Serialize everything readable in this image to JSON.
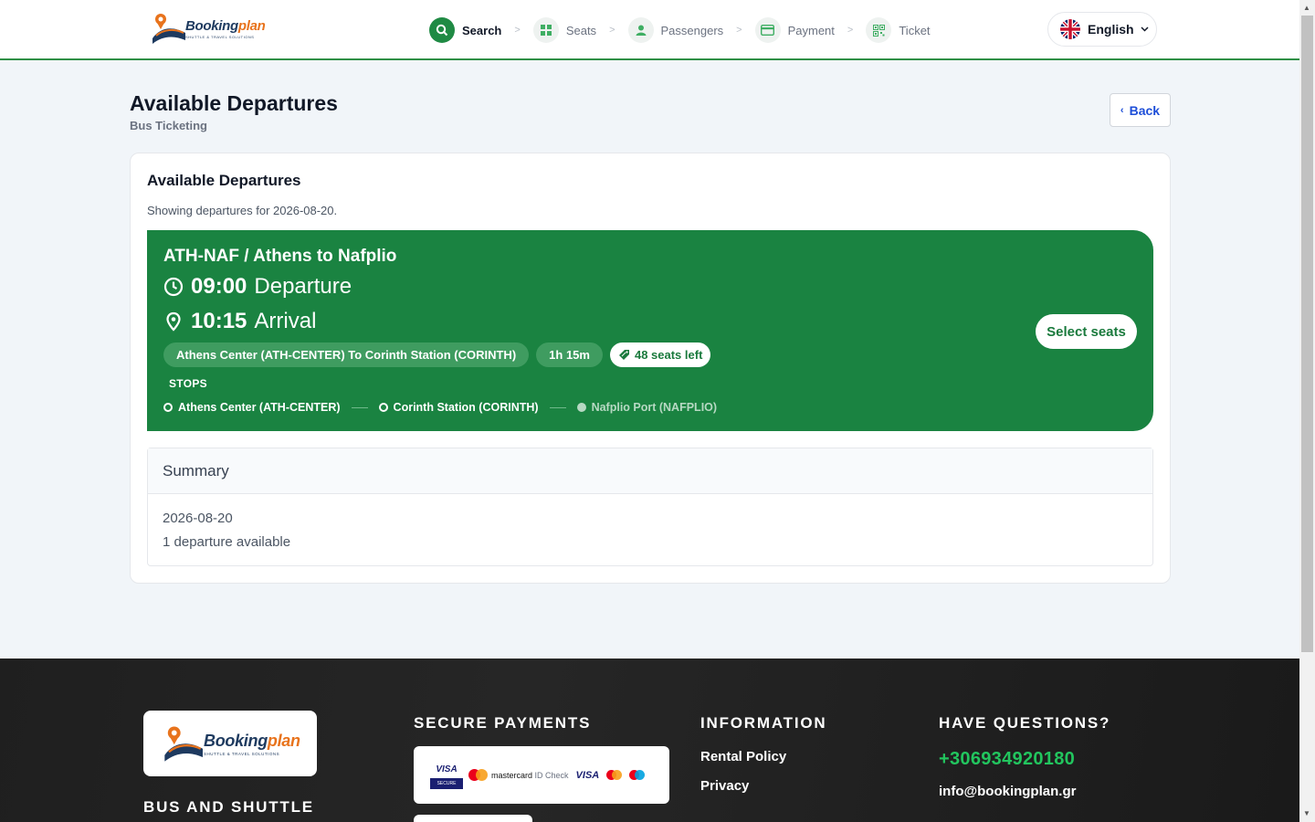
{
  "header": {
    "logo": {
      "word_main": "Booking",
      "word_accent": "plan",
      "tagline": "SHUTTLE & TRAVEL SOLUTIONS"
    },
    "steps": [
      {
        "label": "Search",
        "icon": "search-icon"
      },
      {
        "label": "Seats",
        "icon": "seats-grid-icon"
      },
      {
        "label": "Passengers",
        "icon": "user-icon"
      },
      {
        "label": "Payment",
        "icon": "credit-card-icon"
      },
      {
        "label": "Ticket",
        "icon": "qr-code-icon"
      }
    ],
    "step_separator": ">",
    "active_step": "Search",
    "language": {
      "label": "English",
      "flag": "uk-flag-icon"
    }
  },
  "page": {
    "title": "Available Departures",
    "subtitle": "Bus Ticketing",
    "back_label": "Back"
  },
  "card": {
    "title": "Available Departures",
    "note": "Showing departures for 2026-08-20."
  },
  "departure": {
    "route": "ATH-NAF / Athens to Nafplio",
    "departure_time": "09:00",
    "departure_label": "Departure",
    "arrival_time": "10:15",
    "arrival_label": "Arrival",
    "segment": "Athens Center (ATH-CENTER) To Corinth Station (CORINTH)",
    "duration": "1h 15m",
    "seats_left": "48 seats left",
    "stops_label": "STOPS",
    "stops": [
      "Athens Center (ATH-CENTER)",
      "Corinth Station (CORINTH)",
      "Nafplio Port (NAFPLIO)"
    ],
    "select_label": "Select seats"
  },
  "summary": {
    "heading": "Summary",
    "date": "2026-08-20",
    "count": "1 departure available"
  },
  "footer": {
    "logo": {
      "word_main": "Booking",
      "word_accent": "plan",
      "tagline": "SHUTTLE & TRAVEL SOLUTIONS"
    },
    "brand_heading": "BUS AND SHUTTLE",
    "payments_heading": "SECURE PAYMENTS",
    "payments": {
      "visa_secure_top": "VISA",
      "visa_secure_bottom": "SECURE",
      "mastercard_text": "mastercard",
      "id_check": "ID Check",
      "visa": "VISA"
    },
    "info_heading": "INFORMATION",
    "info_links": [
      "Rental Policy",
      "Privacy"
    ],
    "questions_heading": "HAVE QUESTIONS?",
    "phone": "+306934920180",
    "email": "info@bookingplan.gr"
  },
  "colors": {
    "brand_green": "#1a8341",
    "accent_orange": "#e8731c",
    "link_blue": "#1d4ed8",
    "footer_phone": "#22c55e"
  }
}
